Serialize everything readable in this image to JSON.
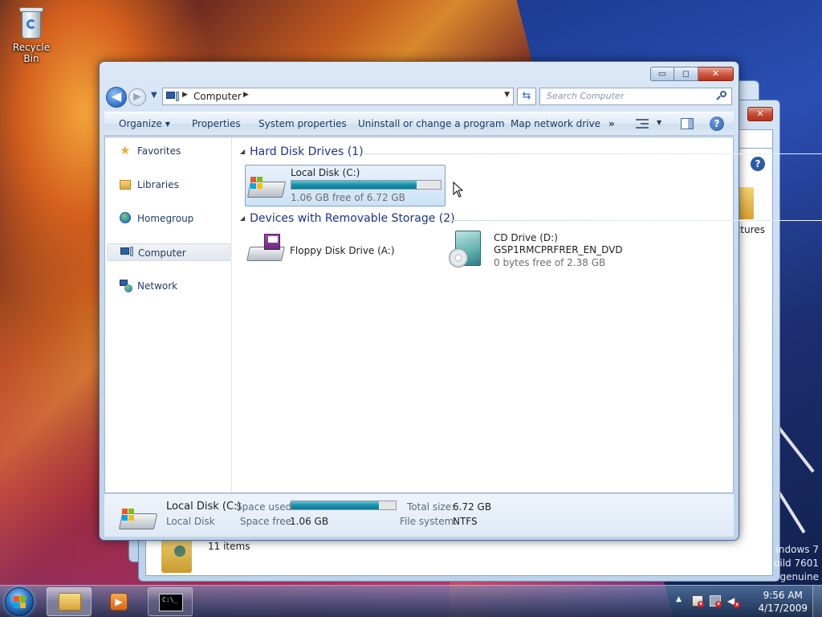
{
  "desktop": {
    "recycle_bin_label": "Recycle Bin",
    "watermark_lines": [
      "indows 7",
      "uild 7601",
      "genuine"
    ]
  },
  "background_window": {
    "items_count": "11 items",
    "folder_label": "ctures",
    "close_label": "✕",
    "help_label": "?"
  },
  "window": {
    "caption": {
      "minimize": "▭",
      "maximize": "◻",
      "close": "✕"
    },
    "nav": {
      "back": "◀",
      "forward": "▶",
      "recent_dropdown": "▼"
    },
    "address": {
      "crumb": "Computer",
      "separator": "▶",
      "dropdown": "▼"
    },
    "refresh": "⇆",
    "search": {
      "placeholder": "Search Computer"
    },
    "commands": {
      "organize": "Organize",
      "organize_arrow": "▼",
      "properties": "Properties",
      "system_properties": "System properties",
      "uninstall": "Uninstall or change a program",
      "map_network": "Map network drive",
      "more": "»",
      "view_arrow": "▼",
      "help": "?"
    },
    "nav_pane": [
      {
        "label": "Favorites",
        "icon": "star-icon"
      },
      {
        "label": "Libraries",
        "icon": "libraries-icon"
      },
      {
        "label": "Homegroup",
        "icon": "homegroup-icon"
      },
      {
        "label": "Computer",
        "icon": "computer-icon",
        "selected": true
      },
      {
        "label": "Network",
        "icon": "network-icon"
      }
    ],
    "groups": {
      "hard_disk": {
        "title": "Hard Disk Drives (1)",
        "toggle": "◢"
      },
      "removable": {
        "title": "Devices with Removable Storage (2)",
        "toggle": "◢"
      }
    },
    "drives": {
      "c": {
        "name": "Local Disk (C:)",
        "free": "1.06 GB free of 6.72 GB",
        "used_fraction": 0.84
      },
      "a": {
        "name": "Floppy Disk Drive (A:)"
      },
      "d": {
        "name": "CD Drive (D:)",
        "volume": "GSP1RMCPRFRER_EN_DVD",
        "free": "0 bytes free of 2.38 GB"
      }
    },
    "details": {
      "name": "Local Disk (C:)",
      "type": "Local Disk",
      "space_used_label": "Space used:",
      "space_used_fraction": 0.84,
      "space_free_label": "Space free:",
      "space_free_value": "1.06 GB",
      "total_size_label": "Total size:",
      "total_size_value": "6.72 GB",
      "file_system_label": "File system:",
      "file_system_value": "NTFS"
    }
  },
  "taskbar": {
    "pinned": [
      {
        "name": "explorer",
        "icon": "folder-icon",
        "active": true
      },
      {
        "name": "media-player",
        "icon": "media-player-icon"
      },
      {
        "name": "command-prompt",
        "icon": "cmd-icon",
        "text": "C:\\_"
      }
    ],
    "tray": {
      "show_hidden": "▲"
    },
    "clock": {
      "time": "9:56 AM",
      "date": "4/17/2009"
    }
  }
}
